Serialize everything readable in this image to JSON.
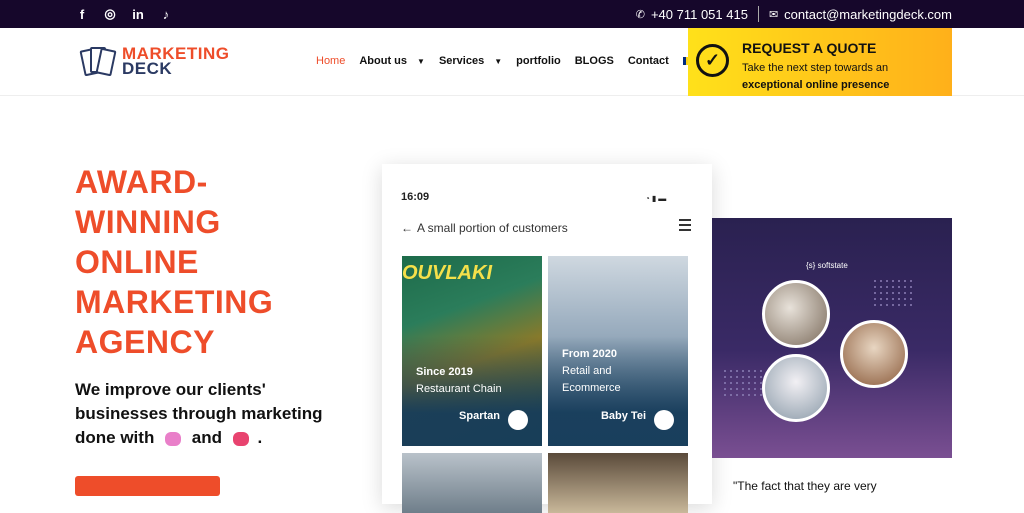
{
  "topbar": {
    "social": [
      {
        "icon": "facebook-icon",
        "glyph": "f"
      },
      {
        "icon": "instagram-icon",
        "glyph": "◎"
      },
      {
        "icon": "linkedin-icon",
        "glyph": "in"
      },
      {
        "icon": "tiktok-icon",
        "glyph": "♪"
      }
    ],
    "phone": "+40 711 051 415",
    "email": "contact@marketingdeck.com"
  },
  "logo": {
    "line1": "MARKETING",
    "line2": "DECK"
  },
  "nav": {
    "home": "Home",
    "about": "About us",
    "services": "Services",
    "portfolio": "portfolio",
    "blogs": "BLOGS",
    "contact": "Contact"
  },
  "quote_box": {
    "title": "REQUEST A QUOTE",
    "line1": "Take the next step towards an",
    "line2": "exceptional online presence"
  },
  "hero": {
    "headline_lines": [
      "AWARD-",
      "WINNING",
      "ONLINE",
      "MARKETING",
      "AGENCY"
    ],
    "sub_line1": "We improve our clients'",
    "sub_line2": "businesses through marketing",
    "sub_line3_a": "done with",
    "sub_line3_b": "and",
    "sub_line3_c": "."
  },
  "phone": {
    "time": "16:09",
    "title": "A small portion of customers",
    "cards": [
      {
        "since": "Since 2019",
        "category": "Restaurant Chain",
        "name": "Spartan"
      },
      {
        "since": "From 2020",
        "category_1": "Retail and",
        "category_2": "Ecommerce",
        "name": "Baby Tei"
      }
    ]
  },
  "right_card": {
    "brand": "{s} softstate"
  },
  "testimonial": {
    "text": "\"The fact that they are very"
  },
  "colors": {
    "accent": "#ee4d2a",
    "navy": "#16072b",
    "quote_yellow": "#ffc21a"
  }
}
